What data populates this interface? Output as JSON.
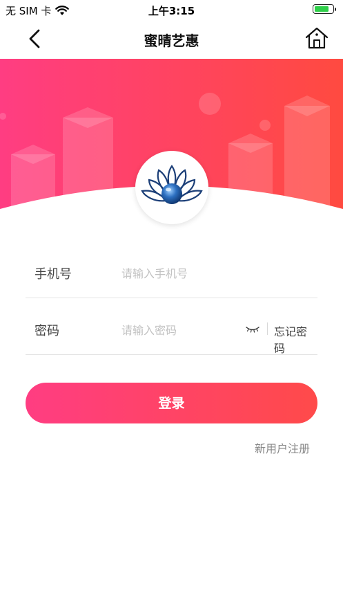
{
  "status_bar": {
    "carrier": "无 SIM 卡",
    "time": "上午3:15",
    "battery_level": 0.85,
    "battery_color": "#2fcf4a"
  },
  "nav": {
    "title": "蜜晴艺惠",
    "back_icon": "chevron-left-icon",
    "home_icon": "home-icon"
  },
  "hero": {
    "gradient_start": "#ff3d82",
    "gradient_end": "#ff4a40"
  },
  "form": {
    "phone": {
      "label": "手机号",
      "placeholder": "请输入手机号",
      "value": ""
    },
    "password": {
      "label": "密码",
      "placeholder": "请输入密码",
      "value": "",
      "toggle_icon": "eye-closed-icon",
      "forgot_label": "忘记密码"
    }
  },
  "actions": {
    "login_label": "登录",
    "register_label": "新用户注册"
  }
}
